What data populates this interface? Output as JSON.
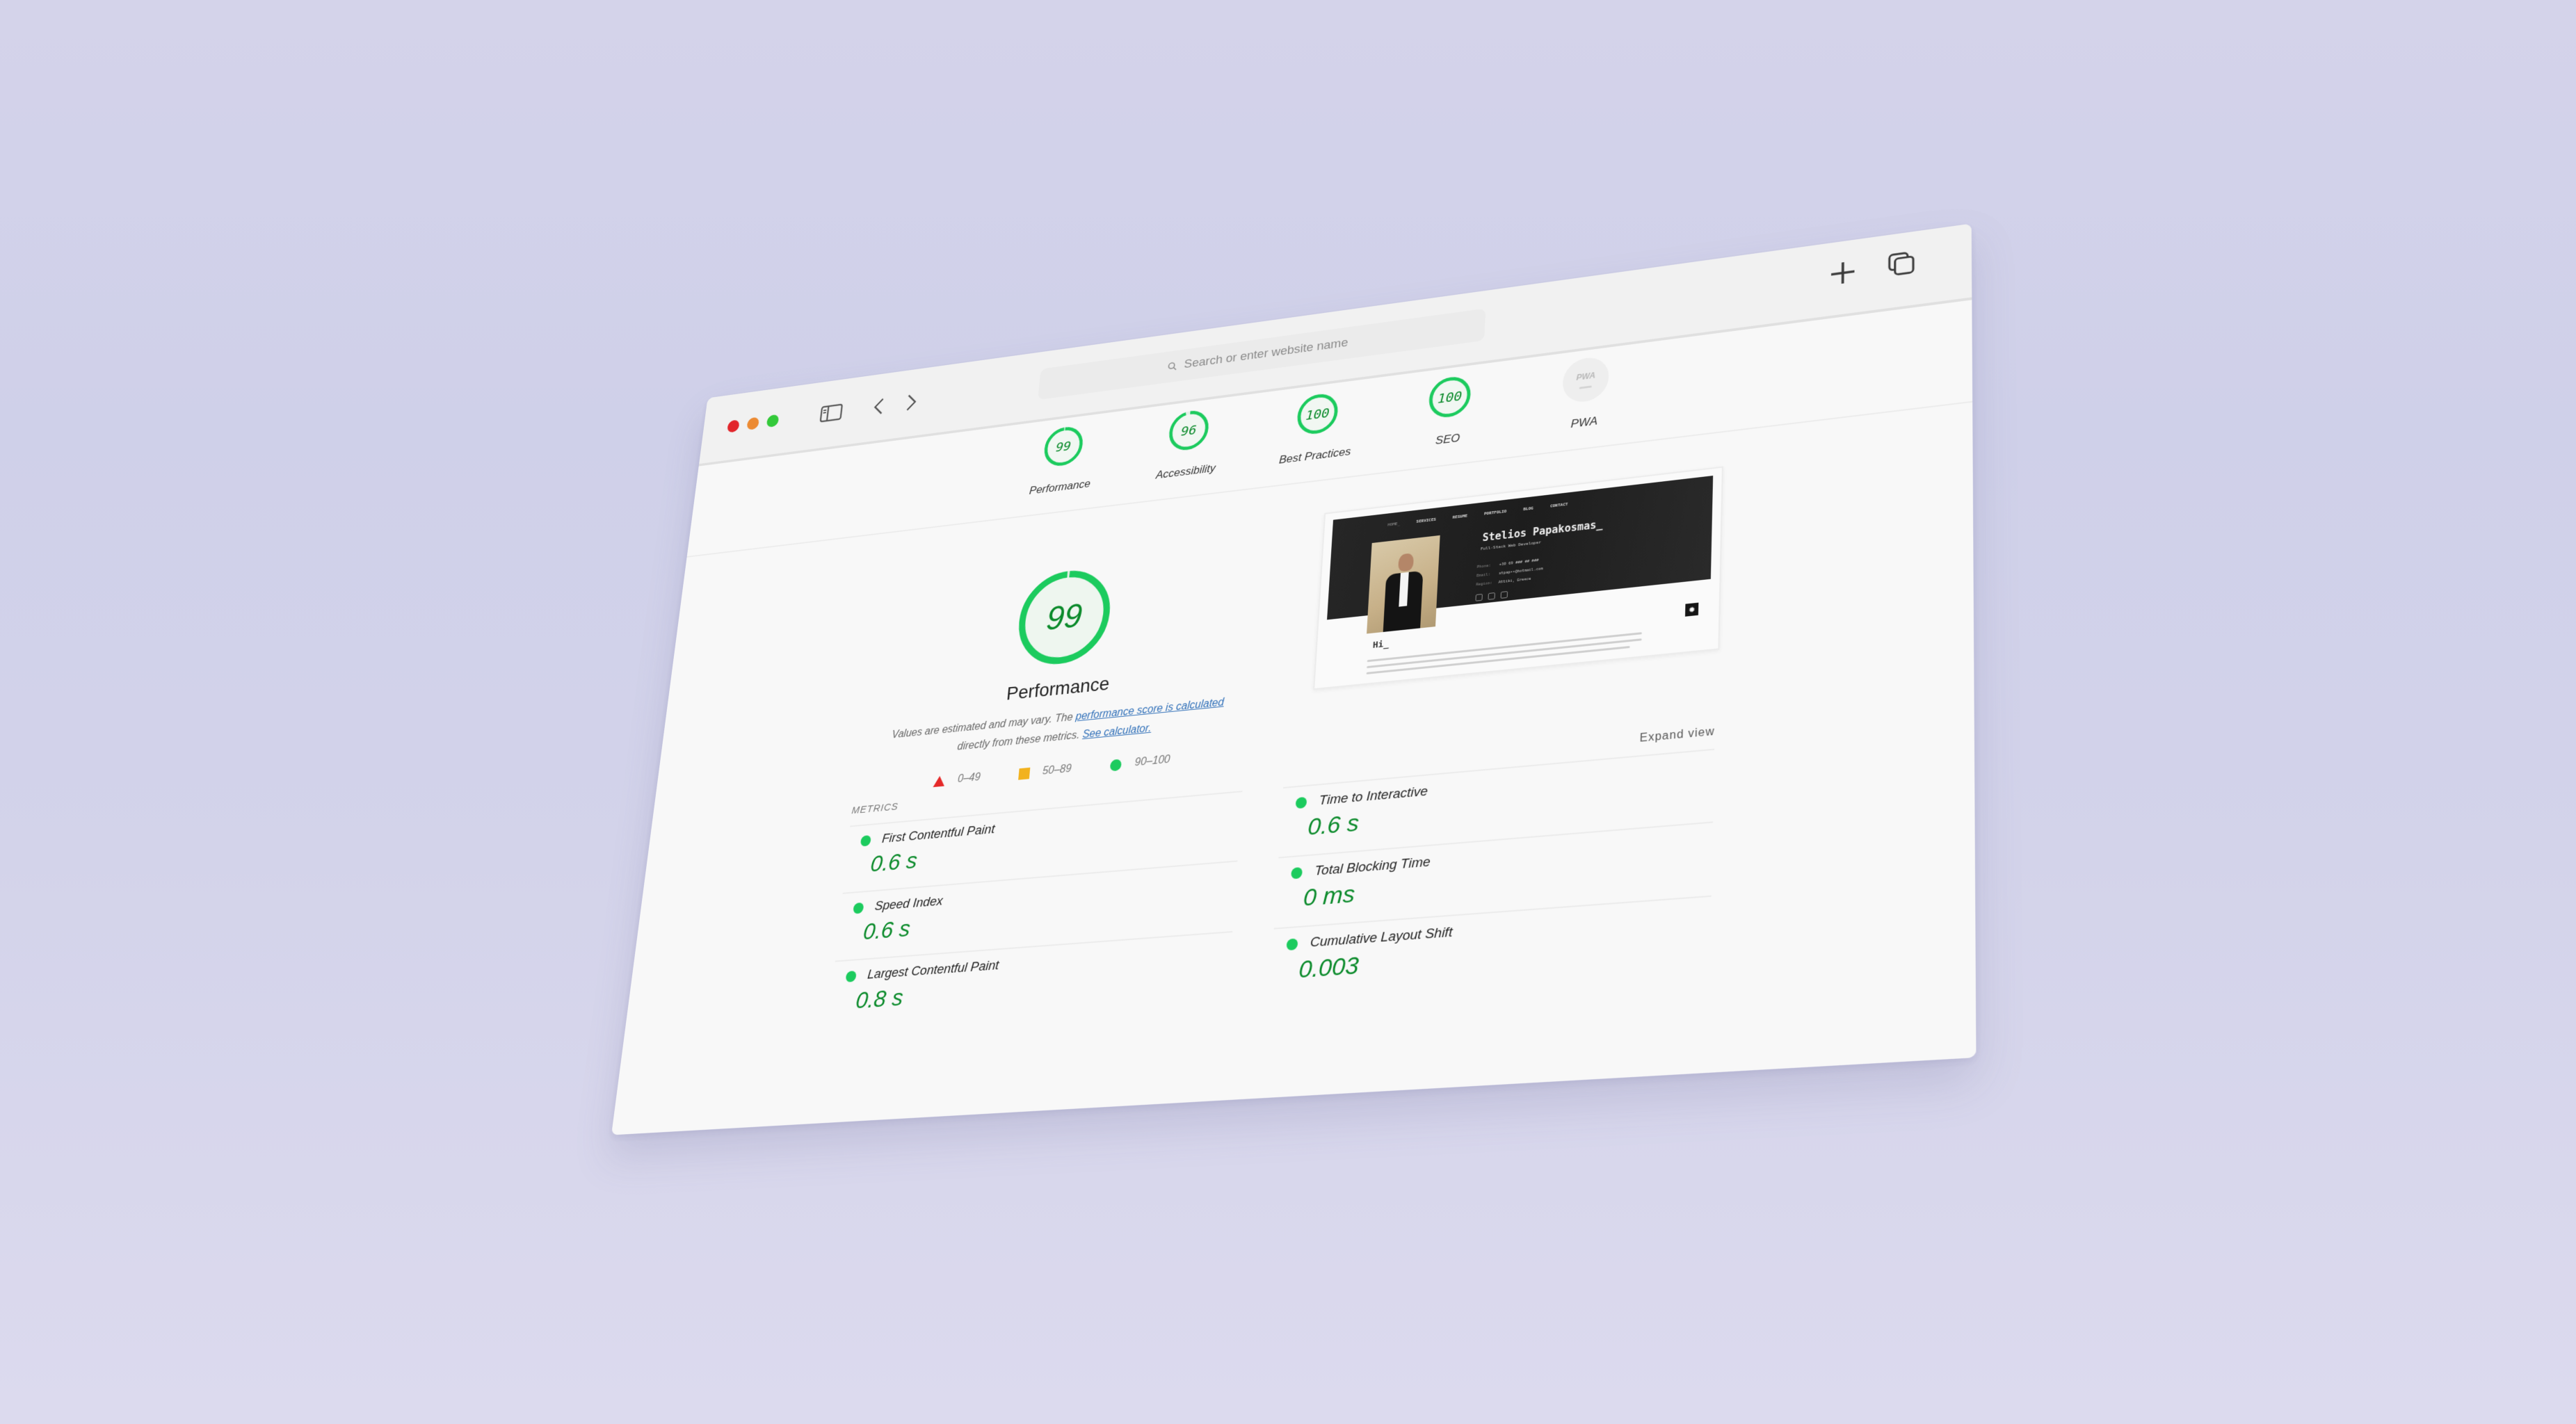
{
  "browser": {
    "address_placeholder": "Search or enter website name",
    "icons": {
      "sidebar": "sidebar-icon",
      "back": "chevron-left-icon",
      "forward": "chevron-right-icon",
      "new_tab": "plus-icon",
      "tabs": "tabs-overview-icon",
      "search": "search-icon"
    },
    "traffic_lights": [
      "close",
      "minimize",
      "zoom"
    ]
  },
  "colors": {
    "pass": "#1ccb5e",
    "pass_text": "#0a8a2a",
    "average": "#f2b21e",
    "fail": "#e52929",
    "link": "#2f6fb8",
    "background": "#d4d3ea"
  },
  "categories": [
    {
      "label": "Performance",
      "score": "99",
      "value": 99
    },
    {
      "label": "Accessibility",
      "score": "96",
      "value": 96
    },
    {
      "label": "Best Practices",
      "score": "100",
      "value": 100
    },
    {
      "label": "SEO",
      "score": "100",
      "value": 100
    },
    {
      "label": "PWA",
      "badge": "PWA",
      "score": "—"
    }
  ],
  "performance": {
    "score": "99",
    "value": 99,
    "title": "Performance",
    "desc_prefix": "Values are estimated and may vary. The ",
    "desc_link1": "performance score is calculated",
    "desc_middle": " directly from these metrics. ",
    "desc_link2": "See calculator."
  },
  "legend": [
    {
      "shape": "triangle",
      "range": "0–49"
    },
    {
      "shape": "square",
      "range": "50–89"
    },
    {
      "shape": "circle",
      "range": "90–100"
    }
  ],
  "page_screenshot": {
    "nav": [
      "HOME_",
      "SERVICES",
      "RESUME",
      "PORTFOLIO",
      "BLOG",
      "CONTACT"
    ],
    "name": "Stelios Papakosmas_",
    "subtitle": "Full-Stack Web Developer",
    "rows": [
      {
        "key": "Phone:",
        "value": "+30 69 ### ## ###"
      },
      {
        "key": "Email:",
        "value": "stpap••@hotmail.com"
      },
      {
        "key": "Region:",
        "value": "Attiki, Greece"
      }
    ],
    "greeting": "Hi_"
  },
  "metrics": {
    "title": "METRICS",
    "expand_label": "Expand view",
    "items": [
      {
        "name": "First Contentful Paint",
        "value": "0.6 s"
      },
      {
        "name": "Time to Interactive",
        "value": "0.6 s"
      },
      {
        "name": "Speed Index",
        "value": "0.6 s"
      },
      {
        "name": "Total Blocking Time",
        "value": "0 ms"
      },
      {
        "name": "Largest Contentful Paint",
        "value": "0.8 s"
      },
      {
        "name": "Cumulative Layout Shift",
        "value": "0.003"
      }
    ]
  }
}
